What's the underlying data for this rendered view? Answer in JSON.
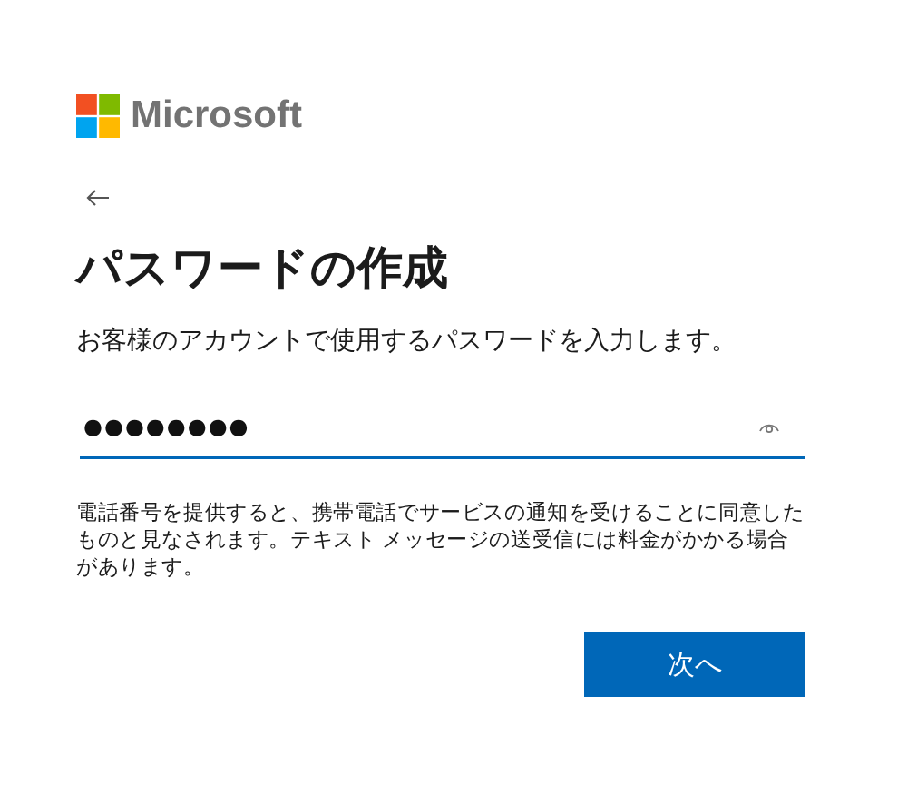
{
  "brand": {
    "name": "Microsoft"
  },
  "heading": "パスワードの作成",
  "description": "お客様のアカウントで使用するパスワードを入力します。",
  "password_field": {
    "value": "●●●●●●●●",
    "focused": true
  },
  "disclaimer": "電話番号を提供すると、携帯電話でサービスの通知を受けることに同意したものと見なされます。テキスト メッセージの送受信には料金がかかる場合があります。",
  "buttons": [
    {
      "label": "次へ",
      "kind": "primary"
    }
  ]
}
